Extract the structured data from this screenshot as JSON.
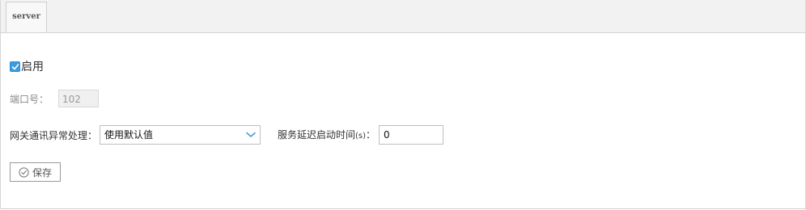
{
  "tab": {
    "label": "server"
  },
  "enable": {
    "label": "启用",
    "checked": true
  },
  "port": {
    "label": "端口号：",
    "value": "102"
  },
  "gateway": {
    "label": "网关通讯异常处理：",
    "selected": "使用默认值"
  },
  "delay": {
    "label": "服务延迟启动时间",
    "unit": "(s)",
    "colon": "：",
    "value": "0"
  },
  "save": {
    "label": "保存"
  },
  "colors": {
    "accent": "#3a9be0",
    "chevron": "#4a9fd8"
  }
}
